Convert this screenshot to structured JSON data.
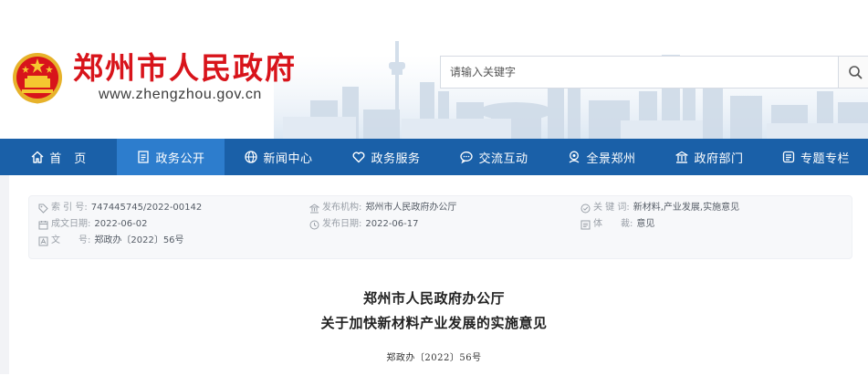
{
  "header": {
    "site_title": "郑州市人民政府",
    "site_url": "www.zhengzhou.gov.cn",
    "search_placeholder": "请输入关键字"
  },
  "nav": {
    "items": [
      {
        "label": "首　页",
        "icon": "home-icon",
        "active": false
      },
      {
        "label": "政务公开",
        "icon": "document-icon",
        "active": true
      },
      {
        "label": "新闻中心",
        "icon": "globe-icon",
        "active": false
      },
      {
        "label": "政务服务",
        "icon": "heart-icon",
        "active": false
      },
      {
        "label": "交流互动",
        "icon": "chat-icon",
        "active": false
      },
      {
        "label": "全景郑州",
        "icon": "panorama-icon",
        "active": false
      },
      {
        "label": "政府部门",
        "icon": "building-icon",
        "active": false
      },
      {
        "label": "专题专栏",
        "icon": "topic-icon",
        "active": false
      }
    ]
  },
  "meta": {
    "index_label": "索 引 号:",
    "index_value": "747445745/2022-00142",
    "issuer_label": "发布机构:",
    "issuer_value": "郑州市人民政府办公厅",
    "keywords_label": "关 键 词:",
    "keywords_value": "新材料,产业发展,实施意见",
    "created_label": "成文日期:",
    "created_value": "2022-06-02",
    "published_label": "发布日期:",
    "published_value": "2022-06-17",
    "genre_label": "体　　裁:",
    "genre_value": "意见",
    "docno_label": "文　　号:",
    "docno_value": "郑政办〔2022〕56号"
  },
  "document": {
    "title_line1": "郑州市人民政府办公厅",
    "title_line2": "关于加快新材料产业发展的实施意见",
    "doc_number": "郑政办〔2022〕56号"
  },
  "colors": {
    "brand_red": "#d8141b",
    "nav_blue": "#1a60a8",
    "nav_active": "#2d7dcd"
  }
}
